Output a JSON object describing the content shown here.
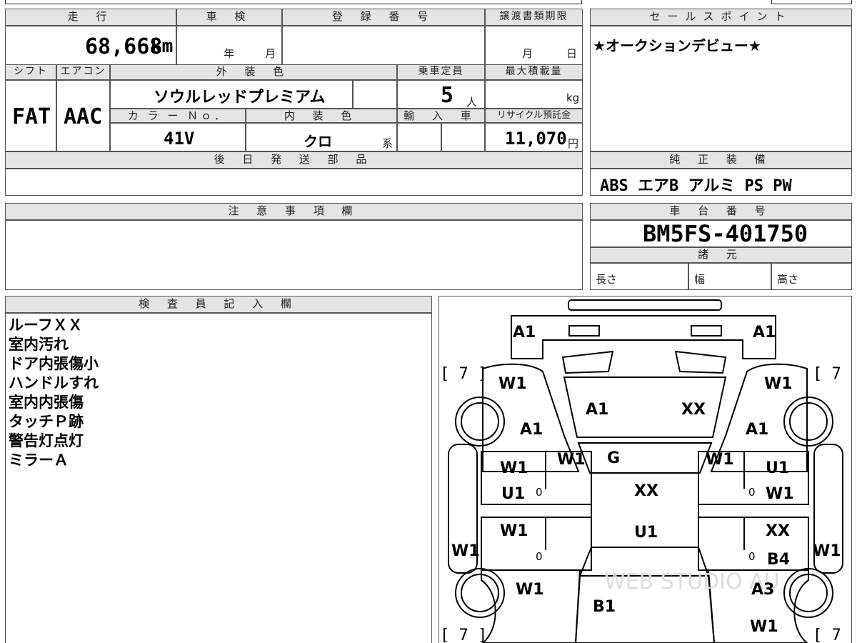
{
  "headers": {
    "mileage": "走 行",
    "inspection": "車 検",
    "registration": "登 録 番 号",
    "transfer_deadline": "譲渡書類期限",
    "sales_point": "セールスポイント",
    "shift": "シフト",
    "aircon": "エアコン",
    "exterior_color": "外 装 色",
    "capacity": "乗車定員",
    "max_load": "最大積載量",
    "color_no": "カ ラ ー Ｎｏ．",
    "interior_color": "内 装 色",
    "import": "輸 入 車",
    "recycle": "リサイクル預託金",
    "later_parts": "後 日 発 送 部 品",
    "genuine_equipment": "純 正 装 備",
    "notes": "注 意 事 項 欄",
    "chassis_no": "車 台 番 号",
    "specs": "諸 元",
    "inspector": "検 査 員 記 入 欄"
  },
  "vehicle": {
    "mileage": "68,668",
    "mileage_unit": "km",
    "year_unit": "年",
    "month_unit": "月",
    "deadline_month": "月",
    "deadline_day": "日",
    "shift": "FAT",
    "aircon": "AAC",
    "exterior_color": "ソウルレッドプレミアム",
    "capacity": "5",
    "capacity_unit": "人",
    "load_unit": "kg",
    "color_no": "41V",
    "interior_color": "クロ",
    "interior_suffix": "系",
    "recycle": "11,070",
    "recycle_unit": "円"
  },
  "sales_point": "★オークションデビュー★",
  "genuine_equipment": "ABS エアB アルミ PS PW",
  "chassis_no": "BM5FS-401750",
  "specs": {
    "length": "長さ",
    "width": "幅",
    "height": "高さ"
  },
  "inspector_notes": [
    "ルーフＸＸ",
    "室内汚れ",
    "ドア内張傷小",
    "ハンドルすれ",
    "室内内張傷",
    "タッチＰ跡",
    "警告灯点灯",
    "ミラーＡ"
  ],
  "diagram": {
    "watermark": "WEB STUDIO AU",
    "codes": {
      "front_left": "A1",
      "front_right": "A1",
      "tire_fl": "7",
      "tire_fr": "7",
      "tire_rl": "7",
      "tire_rr": "7",
      "fender_fl": "W1",
      "fender_fr": "W1",
      "fender_fl_lower": "A1",
      "fender_fr_lower": "A1",
      "hood_left": "A1",
      "hood_right": "XX",
      "pillar_l": "W1",
      "pillar_r": "W1",
      "windshield": "G",
      "roof": "XX",
      "roof_lower": "U1",
      "door_fl_w": "W1",
      "door_fl_u": "U1",
      "door_fr_u": "U1",
      "door_fr_w": "W1",
      "door_rl_w": "W1",
      "door_rr_xx": "XX",
      "door_rr_b": "B4",
      "sill_l": "W1",
      "sill_r": "W1",
      "quarter_rl": "W1",
      "quarter_rr": "A3",
      "trunk": "B1",
      "rear_r": "W1",
      "mark0": "0"
    }
  }
}
